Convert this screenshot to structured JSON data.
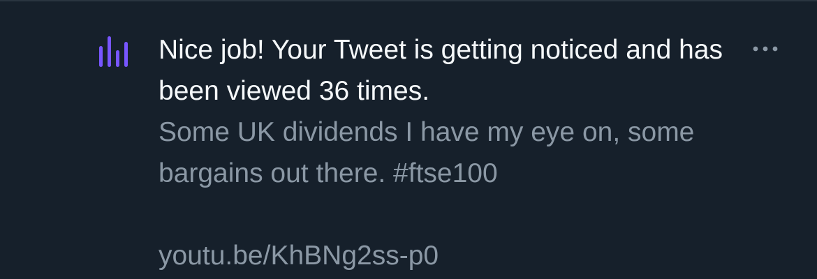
{
  "notification": {
    "icon": "analytics-bars-icon",
    "accent_color": "#7856ff",
    "headline": "Nice job! Your Tweet is getting noticed and has been viewed 36 times.",
    "tweet": {
      "text": "Some UK dividends I have my eye on, some bargains out there. #ftse100",
      "link": "youtu.be/KhBNg2ss-p0"
    },
    "more_icon": "more-options-icon"
  }
}
